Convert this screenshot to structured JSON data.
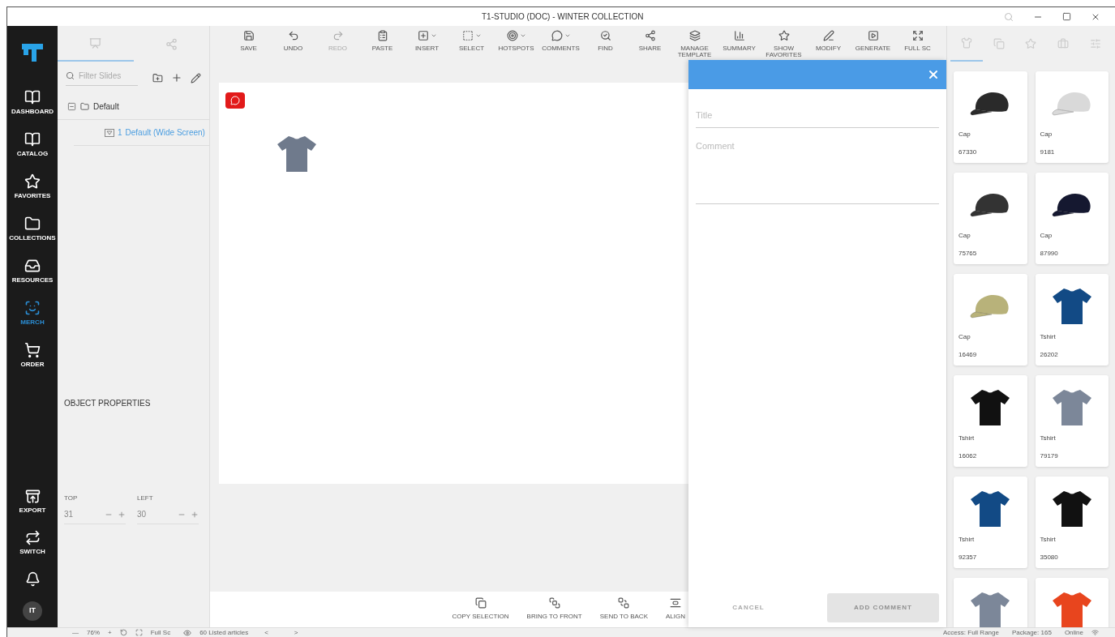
{
  "window": {
    "title": "T1-STUDIO (DOC) - WINTER COLLECTION"
  },
  "nav": [
    {
      "kind": "dashboard",
      "label": "DASHBOARD",
      "selected": false
    },
    {
      "kind": "catalog",
      "label": "CATALOG",
      "selected": false
    },
    {
      "kind": "favorites",
      "label": "FAVORITES",
      "selected": false
    },
    {
      "kind": "collections",
      "label": "COLLECTIONS",
      "selected": false
    },
    {
      "kind": "resources",
      "label": "RESOURCES",
      "selected": false
    },
    {
      "kind": "merch",
      "label": "MERCH",
      "selected": true
    },
    {
      "kind": "order",
      "label": "ORDER",
      "selected": false
    }
  ],
  "nav_bottom": [
    {
      "kind": "export",
      "label": "EXPORT"
    },
    {
      "kind": "switch",
      "label": "SWITCH"
    },
    {
      "kind": "bell"
    }
  ],
  "avatar": "IT",
  "left_panel": {
    "tabs": [
      {
        "kind": "slides",
        "selected": true
      },
      {
        "kind": "share",
        "selected": false
      }
    ],
    "search": {
      "placeholder": "Filter Slides"
    },
    "tree": [
      {
        "label": "Default",
        "expanded": true,
        "children": [
          {
            "number": "1",
            "label": "Default (Wide Screen)",
            "selected": true
          }
        ]
      }
    ],
    "properties_title": "OBJECT PROPERTIES",
    "fields": [
      {
        "label": "TOP",
        "value": "31"
      },
      {
        "label": "LEFT",
        "value": "30"
      }
    ]
  },
  "toolbar": [
    {
      "kind": "save",
      "label": "SAVE",
      "disabled": false,
      "dropdown": false
    },
    {
      "kind": "undo",
      "label": "UNDO",
      "disabled": false,
      "dropdown": false
    },
    {
      "kind": "redo",
      "label": "REDO",
      "disabled": true,
      "dropdown": false
    },
    {
      "kind": "paste",
      "label": "PASTE",
      "disabled": false,
      "dropdown": false
    },
    {
      "kind": "insert",
      "label": "INSERT",
      "disabled": false,
      "dropdown": true
    },
    {
      "kind": "select",
      "label": "SELECT",
      "disabled": false,
      "dropdown": true
    },
    {
      "kind": "hotspots",
      "label": "HOTSPOTS",
      "disabled": false,
      "dropdown": true
    },
    {
      "kind": "comments",
      "label": "COMMENTS",
      "disabled": false,
      "dropdown": true
    },
    {
      "kind": "find",
      "label": "FIND",
      "disabled": false,
      "dropdown": false
    },
    {
      "kind": "share",
      "label": "SHARE",
      "disabled": false,
      "dropdown": false
    },
    {
      "kind": "template",
      "label": "MANAGE TEMPLATE",
      "disabled": false,
      "dropdown": false
    },
    {
      "kind": "summary",
      "label": "SUMMARY",
      "disabled": false,
      "dropdown": false
    },
    {
      "kind": "favorites",
      "label": "SHOW FAVORITES",
      "disabled": false,
      "dropdown": false
    },
    {
      "kind": "modify",
      "label": "MODIFY",
      "disabled": false,
      "dropdown": false
    },
    {
      "kind": "generate",
      "label": "GENERATE",
      "disabled": false,
      "dropdown": false
    },
    {
      "kind": "fullscreen",
      "label": "FULL SC",
      "disabled": false,
      "dropdown": false
    }
  ],
  "bottom_toolbar": [
    {
      "kind": "copy",
      "label": "COPY SELECTION"
    },
    {
      "kind": "front",
      "label": "BRING TO FRONT"
    },
    {
      "kind": "back",
      "label": "SEND TO BACK"
    },
    {
      "kind": "align",
      "label": "ALIGN"
    }
  ],
  "comment_panel": {
    "title_placeholder": "Title",
    "comment_placeholder": "Comment",
    "cancel": "CANCEL",
    "submit": "ADD COMMENT",
    "submit_disabled": true
  },
  "right_panel": {
    "tabs": [
      {
        "kind": "shirt",
        "selected": true
      },
      {
        "kind": "copy",
        "selected": false
      },
      {
        "kind": "star",
        "selected": false
      },
      {
        "kind": "case",
        "selected": false
      },
      {
        "kind": "sliders",
        "selected": false
      }
    ],
    "articles": [
      {
        "kind": "cap",
        "color": "#2a2a2a",
        "name": "Cap",
        "number": "67330"
      },
      {
        "kind": "cap",
        "color": "#d9d9d9",
        "name": "Cap",
        "number": "9181"
      },
      {
        "kind": "cap",
        "color": "#333333",
        "name": "Cap",
        "number": "75765"
      },
      {
        "kind": "cap",
        "color": "#151830",
        "name": "Cap",
        "number": "87990"
      },
      {
        "kind": "cap",
        "color": "#b8b27a",
        "name": "Cap",
        "number": "16469"
      },
      {
        "kind": "tshirt",
        "color": "#124a85",
        "name": "Tshirt",
        "number": "26202"
      },
      {
        "kind": "tshirt",
        "color": "#111111",
        "name": "Tshirt",
        "number": "16062"
      },
      {
        "kind": "tshirt",
        "color": "#7c8799",
        "name": "Tshirt",
        "number": "79179"
      },
      {
        "kind": "tshirt",
        "color": "#124a85",
        "name": "Tshirt",
        "number": "92357"
      },
      {
        "kind": "tshirt",
        "color": "#111111",
        "name": "Tshirt",
        "number": "35080"
      },
      {
        "kind": "tshirt",
        "color": "#7c8799"
      },
      {
        "kind": "polo",
        "color": "#e8451e"
      }
    ]
  },
  "status_bar": {
    "zoom_out": "—",
    "zoom": "76%",
    "zoom_in": "+",
    "fit": "Full Sc",
    "listed": "60 Listed articles",
    "prev": "<",
    "next": ">",
    "access": "Access: Full Range",
    "package": "Package: 165",
    "online": "Online"
  }
}
